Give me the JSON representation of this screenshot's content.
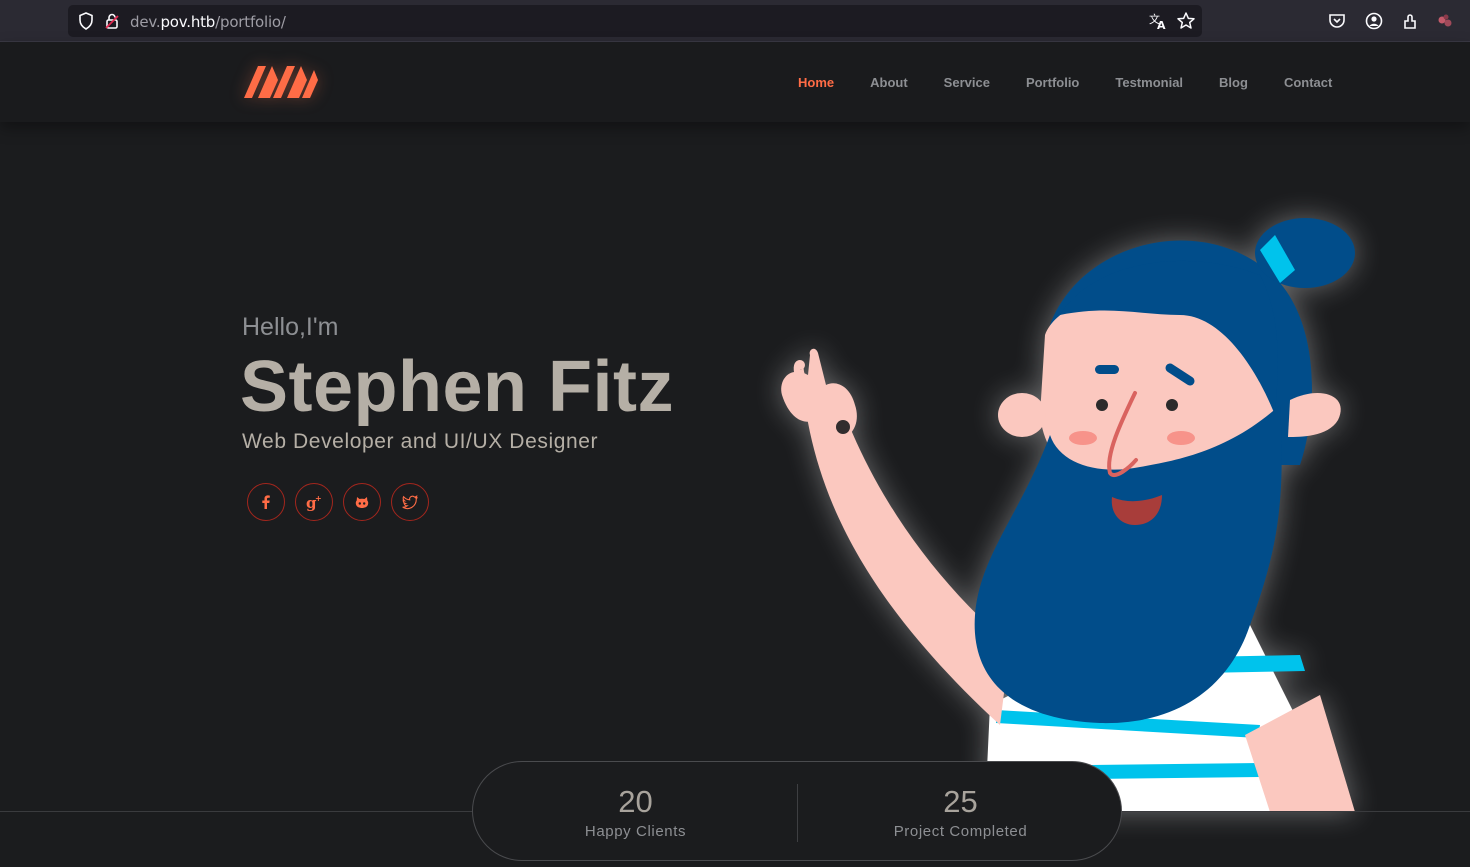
{
  "browser": {
    "url_prefix": "dev.",
    "url_domain": "pov.htb",
    "url_path": "/portfolio/"
  },
  "nav": {
    "items": [
      {
        "label": "Home",
        "active": true
      },
      {
        "label": "About"
      },
      {
        "label": "Service"
      },
      {
        "label": "Portfolio"
      },
      {
        "label": "Testmonial"
      },
      {
        "label": "Blog"
      },
      {
        "label": "Contact"
      }
    ]
  },
  "hero": {
    "greeting": "Hello,I'm",
    "name": "Stephen Fitz",
    "role": "Web Developer and UI/UX Designer",
    "socials": [
      "facebook-icon",
      "google-plus-icon",
      "github-icon",
      "twitter-icon"
    ]
  },
  "stats": [
    {
      "value": "20",
      "label": "Happy Clients"
    },
    {
      "value": "25",
      "label": "Project Completed"
    }
  ],
  "colors": {
    "accent": "#ff6c46",
    "background": "#1b1c1e",
    "heading": "#b5afa6"
  }
}
